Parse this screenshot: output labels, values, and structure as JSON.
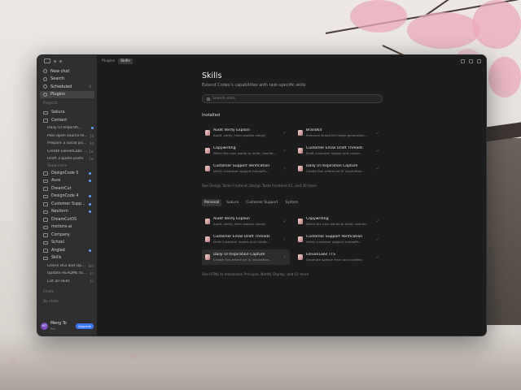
{
  "sidebar": {
    "nav": [
      {
        "label": "New chat",
        "icon": "compose-icon"
      },
      {
        "label": "Search",
        "icon": "search-icon"
      },
      {
        "label": "Scheduled",
        "icon": "clock-icon",
        "badge": "2"
      },
      {
        "label": "Plugins",
        "icon": "plugin-icon",
        "selected": true
      }
    ],
    "projects_label": "Projects",
    "projects": [
      {
        "name": "Sakura"
      },
      {
        "name": "Content",
        "threads": [
          {
            "title": "Daily UI Inspirati...",
            "time": "",
            "dot": true
          },
          {
            "title": "Plan open source fe...",
            "time": "2d",
            "dot": false
          },
          {
            "title": "Prepare 3 social posts",
            "time": "3d",
            "dot": false
          },
          {
            "title": "Create ElevenLabs v...",
            "time": "1w",
            "dot": false
          },
          {
            "title": "Draft 3 quote posts",
            "time": "1w",
            "dot": false
          }
        ],
        "show_more": "Show more"
      },
      {
        "name": "DesignCode 5",
        "dot": true
      },
      {
        "name": "Aura",
        "dot": true
      },
      {
        "name": "DreamCut",
        "dot": false
      },
      {
        "name": "DesignCode 4",
        "dot": true
      },
      {
        "name": "Customer Supp...",
        "dot": true
      },
      {
        "name": "Neuform",
        "dot": true
      },
      {
        "name": "DreamCutOS",
        "dot": false
      },
      {
        "name": "motions-ai",
        "dot": false
      },
      {
        "name": "Company",
        "dot": false
      },
      {
        "name": "School",
        "dot": false
      },
      {
        "name": "Angled",
        "dot": true
      },
      {
        "name": "Skills",
        "threads": [
          {
            "title": "Check OGI and Open...",
            "time": "8m",
            "dot": false
          },
          {
            "title": "Update README for ...",
            "time": "1h",
            "dot": false
          },
          {
            "title": "List all skills",
            "time": "1h",
            "dot": false
          }
        ]
      }
    ],
    "chats_label": "Chats",
    "no_chats": "No chats",
    "user": {
      "initials": "MT",
      "name": "Meng To",
      "plan": "Pro",
      "upgrade": "Upgrade"
    }
  },
  "topbar": {
    "crumbs": [
      "Plugins",
      "Skills"
    ]
  },
  "main": {
    "title": "Skills",
    "subtitle": "Extend Codex's capabilities with task-specific skills",
    "search_placeholder": "Search skills",
    "installed_label": "Installed",
    "installed": [
      {
        "name": "Audit Verify Explain",
        "desc": "Audit, verify, then explain simply"
      },
      {
        "name": "Brandkit",
        "desc": "Premium brand kit image generation..."
      },
      {
        "name": "Copywriting",
        "desc": "When the user wants to write, rewrite..."
      },
      {
        "name": "Customer Email Draft Threads",
        "desc": "Draft customer replies and create..."
      },
      {
        "name": "Customer Support Verification",
        "desc": "Verify customer support handoffs..."
      },
      {
        "name": "Daily UI Inspiration Capture",
        "desc": "Create five-reference UI inspiration..."
      }
    ],
    "installed_more": "See Design Taste Frontend, Design Taste Frontend V1, and 30 more",
    "tabs": [
      "Personal",
      "Sakura",
      "Customer Support",
      "System"
    ],
    "personal": [
      {
        "name": "Audit Verify Explain",
        "desc": "Audit, verify, then explain simply"
      },
      {
        "name": "Copywriting",
        "desc": "When the user wants to write, rewrite..."
      },
      {
        "name": "Customer Email Draft Threads",
        "desc": "Draft customer replies and create..."
      },
      {
        "name": "Customer Support Verification",
        "desc": "Verify customer support handoffs..."
      },
      {
        "name": "Daily UI Inspiration Capture",
        "desc": "Create five-reference UI inspiration...",
        "highlight": true
      },
      {
        "name": "ElevenLabs TTS",
        "desc": "Generate speech from local profiles"
      }
    ],
    "personal_more": "See HTML to Interaction Principle, Netlify Deploy, and 11 more"
  }
}
